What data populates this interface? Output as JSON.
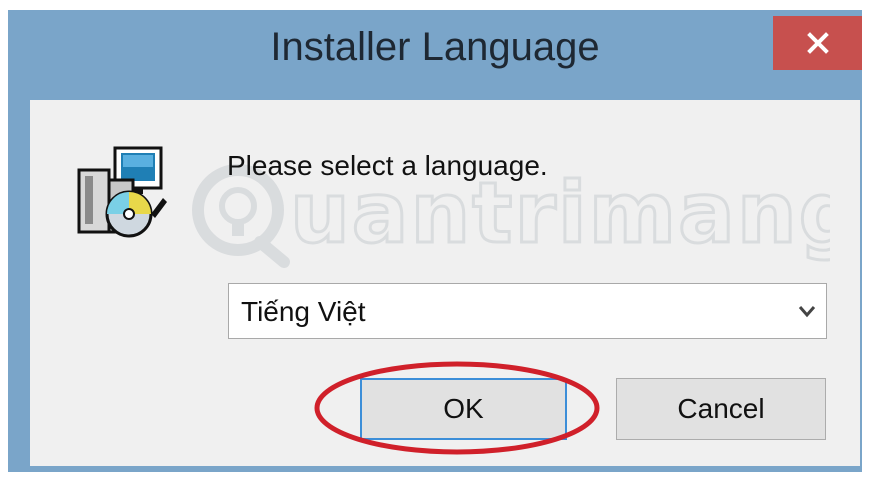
{
  "window": {
    "title": "Installer Language",
    "close_icon": "close-icon",
    "titlebar_color": "#7aa5c9",
    "close_color": "#c7504e"
  },
  "dialog": {
    "icon": "installer-icon",
    "prompt": "Please select a language.",
    "language_select": {
      "selected": "Tiếng Việt",
      "arrow_icon": "chevron-down-icon"
    },
    "buttons": {
      "ok_label": "OK",
      "cancel_label": "Cancel"
    },
    "highlight_color": "#d0202a"
  },
  "watermark": {
    "text": "uantrimang"
  }
}
